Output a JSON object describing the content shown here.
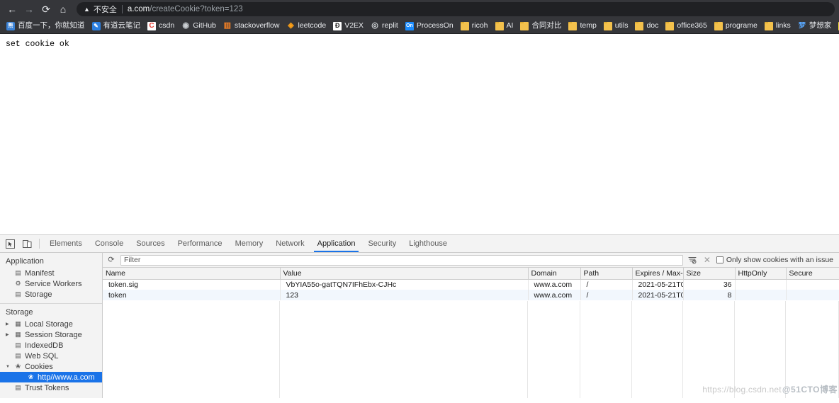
{
  "browser": {
    "nav": {
      "back_icon": "arrow-left-icon",
      "forward_icon": "arrow-right-icon",
      "reload_icon": "reload-icon",
      "home_icon": "home-icon"
    },
    "omnibox": {
      "security_icon": "warning-triangle-icon",
      "security_label": "不安全",
      "url_host": "a.com",
      "url_path": "/createCookie?token=123"
    },
    "bookmarks": [
      {
        "label": "百度一下，你就知道",
        "icon": "baidu-icon",
        "icon_class": "ico-baidu",
        "glyph": "熊"
      },
      {
        "label": "有道云笔记",
        "icon": "youdao-icon",
        "icon_class": "ico-youdao",
        "glyph": "✎"
      },
      {
        "label": "csdn",
        "icon": "csdn-icon",
        "icon_class": "ico-csdn",
        "glyph": "C"
      },
      {
        "label": "GitHub",
        "icon": "github-icon",
        "icon_class": "ico-github",
        "glyph": "◉"
      },
      {
        "label": "stackoverflow",
        "icon": "stackoverflow-icon",
        "icon_class": "ico-so",
        "glyph": "▥"
      },
      {
        "label": "leetcode",
        "icon": "leetcode-icon",
        "icon_class": "ico-leet",
        "glyph": "◈"
      },
      {
        "label": "V2EX",
        "icon": "v2ex-icon",
        "icon_class": "ico-v2ex",
        "glyph": "Ð"
      },
      {
        "label": "replit",
        "icon": "replit-icon",
        "icon_class": "ico-replit",
        "glyph": "◎"
      },
      {
        "label": "ProcessOn",
        "icon": "processon-icon",
        "icon_class": "ico-pon",
        "glyph": "On"
      },
      {
        "label": "ricoh",
        "icon": "folder-icon",
        "icon_class": "ico-folder",
        "glyph": ""
      },
      {
        "label": "AI",
        "icon": "folder-icon",
        "icon_class": "ico-folder",
        "glyph": ""
      },
      {
        "label": "合同对比",
        "icon": "folder-icon",
        "icon_class": "ico-folder",
        "glyph": ""
      },
      {
        "label": "temp",
        "icon": "folder-icon",
        "icon_class": "ico-folder",
        "glyph": ""
      },
      {
        "label": "utils",
        "icon": "folder-icon",
        "icon_class": "ico-folder",
        "glyph": ""
      },
      {
        "label": "doc",
        "icon": "folder-icon",
        "icon_class": "ico-folder",
        "glyph": ""
      },
      {
        "label": "office365",
        "icon": "folder-icon",
        "icon_class": "ico-folder",
        "glyph": ""
      },
      {
        "label": "programe",
        "icon": "folder-icon",
        "icon_class": "ico-folder",
        "glyph": ""
      },
      {
        "label": "links",
        "icon": "folder-icon",
        "icon_class": "ico-folder",
        "glyph": ""
      },
      {
        "label": "梦想家",
        "icon": "dreamer-icon",
        "icon_class": "ico-dream",
        "glyph": "梦"
      },
      {
        "label": "",
        "icon": "es-icon",
        "icon_class": "ico-es",
        "glyph": "ES"
      }
    ]
  },
  "page": {
    "body_text": "set cookie ok"
  },
  "devtools": {
    "toolbar_icons": {
      "inspect": "inspect-element-icon",
      "device": "device-toolbar-icon"
    },
    "tabs": [
      {
        "label": "Elements",
        "active": false
      },
      {
        "label": "Console",
        "active": false
      },
      {
        "label": "Sources",
        "active": false
      },
      {
        "label": "Performance",
        "active": false
      },
      {
        "label": "Memory",
        "active": false
      },
      {
        "label": "Network",
        "active": false
      },
      {
        "label": "Application",
        "active": true
      },
      {
        "label": "Security",
        "active": false
      },
      {
        "label": "Lighthouse",
        "active": false
      }
    ],
    "sidebar": {
      "sections": [
        {
          "title": "Application",
          "items": [
            {
              "label": "Manifest",
              "icon": "document-icon",
              "glyph": "▤",
              "arrow": "",
              "indent": 1,
              "selected": false
            },
            {
              "label": "Service Workers",
              "icon": "gear-icon",
              "glyph": "⚙",
              "arrow": "",
              "indent": 1,
              "selected": false
            },
            {
              "label": "Storage",
              "icon": "database-icon",
              "glyph": "▤",
              "arrow": "",
              "indent": 1,
              "selected": false
            }
          ]
        },
        {
          "title": "Storage",
          "items": [
            {
              "label": "Local Storage",
              "icon": "table-icon",
              "glyph": "▦",
              "arrow": "▶",
              "indent": 1,
              "selected": false
            },
            {
              "label": "Session Storage",
              "icon": "table-icon",
              "glyph": "▦",
              "arrow": "▶",
              "indent": 1,
              "selected": false
            },
            {
              "label": "IndexedDB",
              "icon": "database-icon",
              "glyph": "▤",
              "arrow": "",
              "indent": 1,
              "selected": false
            },
            {
              "label": "Web SQL",
              "icon": "database-icon",
              "glyph": "▤",
              "arrow": "",
              "indent": 1,
              "selected": false
            },
            {
              "label": "Cookies",
              "icon": "cookie-icon",
              "glyph": "❀",
              "arrow": "▼",
              "indent": 1,
              "selected": false
            },
            {
              "label": "http//www.a.com",
              "icon": "cookie-icon",
              "glyph": "❀",
              "arrow": "",
              "indent": 2,
              "selected": true
            },
            {
              "label": "Trust Tokens",
              "icon": "database-icon",
              "glyph": "▤",
              "arrow": "",
              "indent": 1,
              "selected": false
            }
          ]
        }
      ]
    },
    "cookie_toolbar": {
      "refresh_icon": "refresh-icon",
      "filter_placeholder": "Filter",
      "filter_value": "",
      "clear_filtered_icon": "clear-filtered-icon",
      "clear_all_icon": "close-x-icon",
      "issue_checkbox_label": "Only show cookies with an issue",
      "issue_checkbox_checked": false
    },
    "cookie_table": {
      "columns": [
        {
          "key": "name",
          "label": "Name",
          "class": "col-name"
        },
        {
          "key": "value",
          "label": "Value",
          "class": "col-value"
        },
        {
          "key": "domain",
          "label": "Domain",
          "class": "col-domain"
        },
        {
          "key": "path",
          "label": "Path",
          "class": "col-path"
        },
        {
          "key": "expires",
          "label": "Expires / Max-...",
          "class": "col-expires"
        },
        {
          "key": "size",
          "label": "Size",
          "class": "col-size"
        },
        {
          "key": "httponly",
          "label": "HttpOnly",
          "class": "col-http"
        },
        {
          "key": "secure",
          "label": "Secure",
          "class": "col-secure"
        }
      ],
      "rows": [
        {
          "name": "token.sig",
          "value": "VbYIA55o-gatTQN7IFhEbx-CJHc",
          "domain": "www.a.com",
          "path": "/",
          "expires": "2021-05-21T0...",
          "size": "36",
          "httponly": "",
          "secure": ""
        },
        {
          "name": "token",
          "value": "123",
          "domain": "www.a.com",
          "path": "/",
          "expires": "2021-05-21T0...",
          "size": "8",
          "httponly": "",
          "secure": ""
        }
      ]
    }
  },
  "watermark": {
    "text1": "https://blog.csdn.net",
    "text2": "@51CTO博客"
  }
}
